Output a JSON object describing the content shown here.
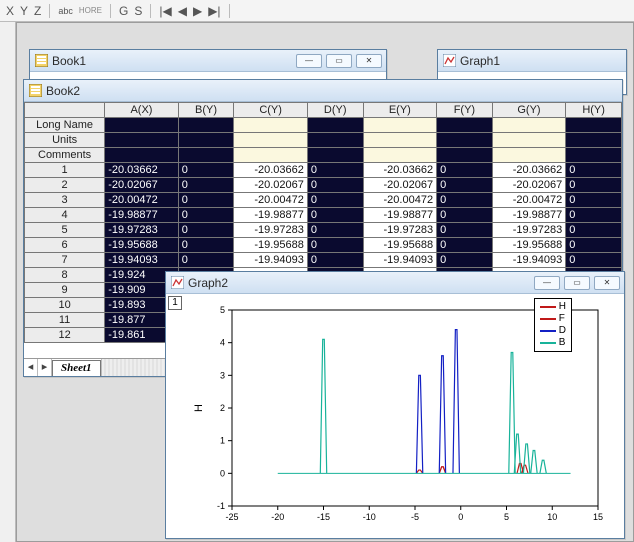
{
  "toolbar": {
    "items": [
      "X",
      "Y",
      "Z",
      "|",
      "abc",
      "HORE",
      "|",
      "G",
      "S",
      "|",
      "|◀",
      "◀",
      "▶",
      "▶|",
      "|"
    ]
  },
  "book1": {
    "title": "Book1"
  },
  "graph1": {
    "title": "Graph1"
  },
  "book2": {
    "title": "Book2",
    "columns": [
      "A(X)",
      "B(Y)",
      "C(Y)",
      "D(Y)",
      "E(Y)",
      "F(Y)",
      "G(Y)",
      "H(Y)"
    ],
    "meta_rows": [
      "Long Name",
      "Units",
      "Comments"
    ],
    "rows": [
      {
        "n": 1,
        "a": "-20.03662",
        "b": "0",
        "c": "-20.03662",
        "d": "0",
        "e": "-20.03662",
        "f": "0",
        "g": "-20.03662",
        "h": "0"
      },
      {
        "n": 2,
        "a": "-20.02067",
        "b": "0",
        "c": "-20.02067",
        "d": "0",
        "e": "-20.02067",
        "f": "0",
        "g": "-20.02067",
        "h": "0"
      },
      {
        "n": 3,
        "a": "-20.00472",
        "b": "0",
        "c": "-20.00472",
        "d": "0",
        "e": "-20.00472",
        "f": "0",
        "g": "-20.00472",
        "h": "0"
      },
      {
        "n": 4,
        "a": "-19.98877",
        "b": "0",
        "c": "-19.98877",
        "d": "0",
        "e": "-19.98877",
        "f": "0",
        "g": "-19.98877",
        "h": "0"
      },
      {
        "n": 5,
        "a": "-19.97283",
        "b": "0",
        "c": "-19.97283",
        "d": "0",
        "e": "-19.97283",
        "f": "0",
        "g": "-19.97283",
        "h": "0"
      },
      {
        "n": 6,
        "a": "-19.95688",
        "b": "0",
        "c": "-19.95688",
        "d": "0",
        "e": "-19.95688",
        "f": "0",
        "g": "-19.95688",
        "h": "0"
      },
      {
        "n": 7,
        "a": "-19.94093",
        "b": "0",
        "c": "-19.94093",
        "d": "0",
        "e": "-19.94093",
        "f": "0",
        "g": "-19.94093",
        "h": "0"
      },
      {
        "n": 8,
        "a": "-19.924",
        "b": "",
        "c": "",
        "d": "",
        "e": "",
        "f": "",
        "g": "",
        "h": ""
      },
      {
        "n": 9,
        "a": "-19.909",
        "b": "",
        "c": "",
        "d": "",
        "e": "",
        "f": "",
        "g": "",
        "h": ""
      },
      {
        "n": 10,
        "a": "-19.893",
        "b": "",
        "c": "",
        "d": "",
        "e": "",
        "f": "",
        "g": "",
        "h": ""
      },
      {
        "n": 11,
        "a": "-19.877",
        "b": "",
        "c": "",
        "d": "",
        "e": "",
        "f": "",
        "g": "",
        "h": ""
      },
      {
        "n": 12,
        "a": "-19.861",
        "b": "",
        "c": "",
        "d": "",
        "e": "",
        "f": "",
        "g": "",
        "h": ""
      }
    ],
    "sheet_tab": "Sheet1"
  },
  "graph2": {
    "title": "Graph2",
    "layer_label": "1",
    "legend": [
      {
        "name": "H",
        "color": "#c01919"
      },
      {
        "name": "F",
        "color": "#c01919"
      },
      {
        "name": "D",
        "color": "#1320c4"
      },
      {
        "name": "B",
        "color": "#18b39a"
      }
    ],
    "ylabel": "H"
  },
  "chart_data": {
    "type": "line",
    "title": "",
    "xlabel": "",
    "ylabel": "H",
    "xlim": [
      -25,
      15
    ],
    "ylim": [
      -1,
      5
    ],
    "xticks": [
      -25,
      -20,
      -15,
      -10,
      -5,
      0,
      5,
      10,
      15
    ],
    "yticks": [
      -1,
      0,
      1,
      2,
      3,
      4,
      5
    ],
    "series": [
      {
        "name": "H",
        "color": "#c01919",
        "peaks": [
          {
            "x": -2,
            "y": 0.2
          },
          {
            "x": 6.5,
            "y": 0.3
          },
          {
            "x": 7.0,
            "y": 0.25
          }
        ]
      },
      {
        "name": "F",
        "color": "#c01919",
        "peaks": [
          {
            "x": -4.5,
            "y": 0.1
          },
          {
            "x": -2.0,
            "y": 0.2
          }
        ]
      },
      {
        "name": "D",
        "color": "#1320c4",
        "peaks": [
          {
            "x": -4.5,
            "y": 3.0
          },
          {
            "x": -2.0,
            "y": 3.6
          },
          {
            "x": -0.5,
            "y": 4.4
          }
        ]
      },
      {
        "name": "B",
        "color": "#18b39a",
        "peaks": [
          {
            "x": -15.0,
            "y": 4.1
          },
          {
            "x": 5.6,
            "y": 3.7
          },
          {
            "x": 6.2,
            "y": 1.2
          },
          {
            "x": 7.2,
            "y": 0.9
          },
          {
            "x": 8.0,
            "y": 0.7
          },
          {
            "x": 9.0,
            "y": 0.4
          }
        ]
      }
    ]
  }
}
